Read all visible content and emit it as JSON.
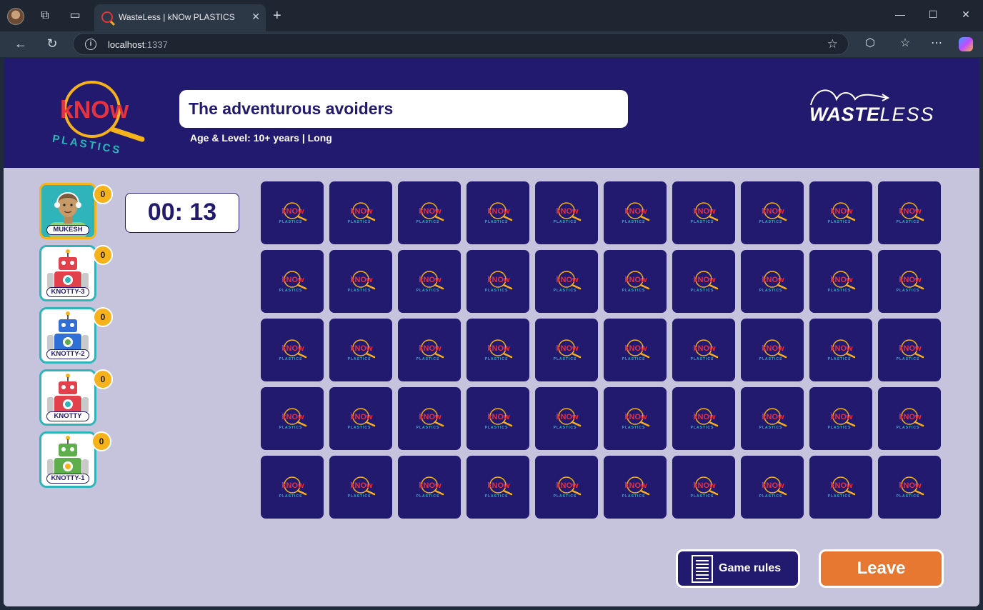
{
  "browser": {
    "tab_title": "WasteLess | kNOw PLASTICS",
    "url_host": "localhost",
    "url_port": ":1337"
  },
  "header": {
    "game_title": "The adventurous avoiders",
    "age_level_label": "Age & Level:",
    "age_level_value": "10+ years | Long",
    "know_logo_word": "kNOw",
    "know_logo_sub": "PLASTICS",
    "brand_bold": "WASTE",
    "brand_light": "LESS"
  },
  "players": [
    {
      "name": "MUKESH",
      "score": "0",
      "active": true,
      "avatar": "person-avatar-icon"
    },
    {
      "name": "KNOTTY-3",
      "score": "0",
      "active": false,
      "avatar": "robot-avatar-icon",
      "color": "#e2404a"
    },
    {
      "name": "KNOTTY-2",
      "score": "0",
      "active": false,
      "avatar": "robot-avatar-icon",
      "color": "#2f6fd6"
    },
    {
      "name": "KNOTTY",
      "score": "0",
      "active": false,
      "avatar": "robot-avatar-icon",
      "color": "#e2404a"
    },
    {
      "name": "KNOTTY-1",
      "score": "0",
      "active": false,
      "avatar": "robot-avatar-icon",
      "color": "#5fae4c"
    }
  ],
  "timer": "00: 13",
  "board": {
    "rows": 5,
    "cols": 10
  },
  "buttons": {
    "rules": "Game rules",
    "leave": "Leave"
  },
  "colors": {
    "navy": "#221a6e",
    "teal": "#2fb5b9",
    "gold": "#f5b21a",
    "orange": "#e67831",
    "lavender": "#c6c3dd"
  }
}
